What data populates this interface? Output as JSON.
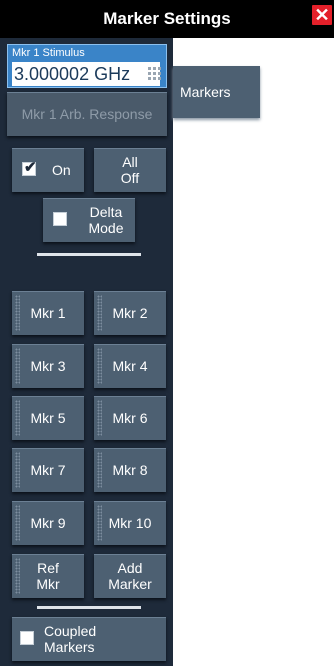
{
  "window": {
    "title": "Marker Settings",
    "close_glyph": "✕"
  },
  "stimulus": {
    "label": "Mkr 1 Stimulus",
    "value": "3.000002 GHz",
    "keypad_icon": "keypad-icon"
  },
  "arb_response": {
    "label": "Mkr 1 Arb. Response",
    "enabled": false
  },
  "on_toggle": {
    "label": "On",
    "checked": true
  },
  "all_off": {
    "line1": "All",
    "line2": "Off"
  },
  "delta_mode": {
    "line1": "Delta",
    "line2": "Mode",
    "checked": false
  },
  "markers": [
    "Mkr 1",
    "Mkr 2",
    "Mkr 3",
    "Mkr 4",
    "Mkr 5",
    "Mkr 6",
    "Mkr 7",
    "Mkr 8",
    "Mkr 9",
    "Mkr 10"
  ],
  "ref_mkr": {
    "line1": "Ref",
    "line2": "Mkr"
  },
  "add_marker": {
    "line1": "Add",
    "line2": "Marker"
  },
  "coupled": {
    "line1": "Coupled",
    "line2": "Markers",
    "checked": false
  },
  "tabs": [
    {
      "label": "Markers"
    }
  ],
  "colors": {
    "panel": "#1e2a3a",
    "button": "#4d6072",
    "selection": "#3a84c8",
    "close": "#e4202a"
  }
}
